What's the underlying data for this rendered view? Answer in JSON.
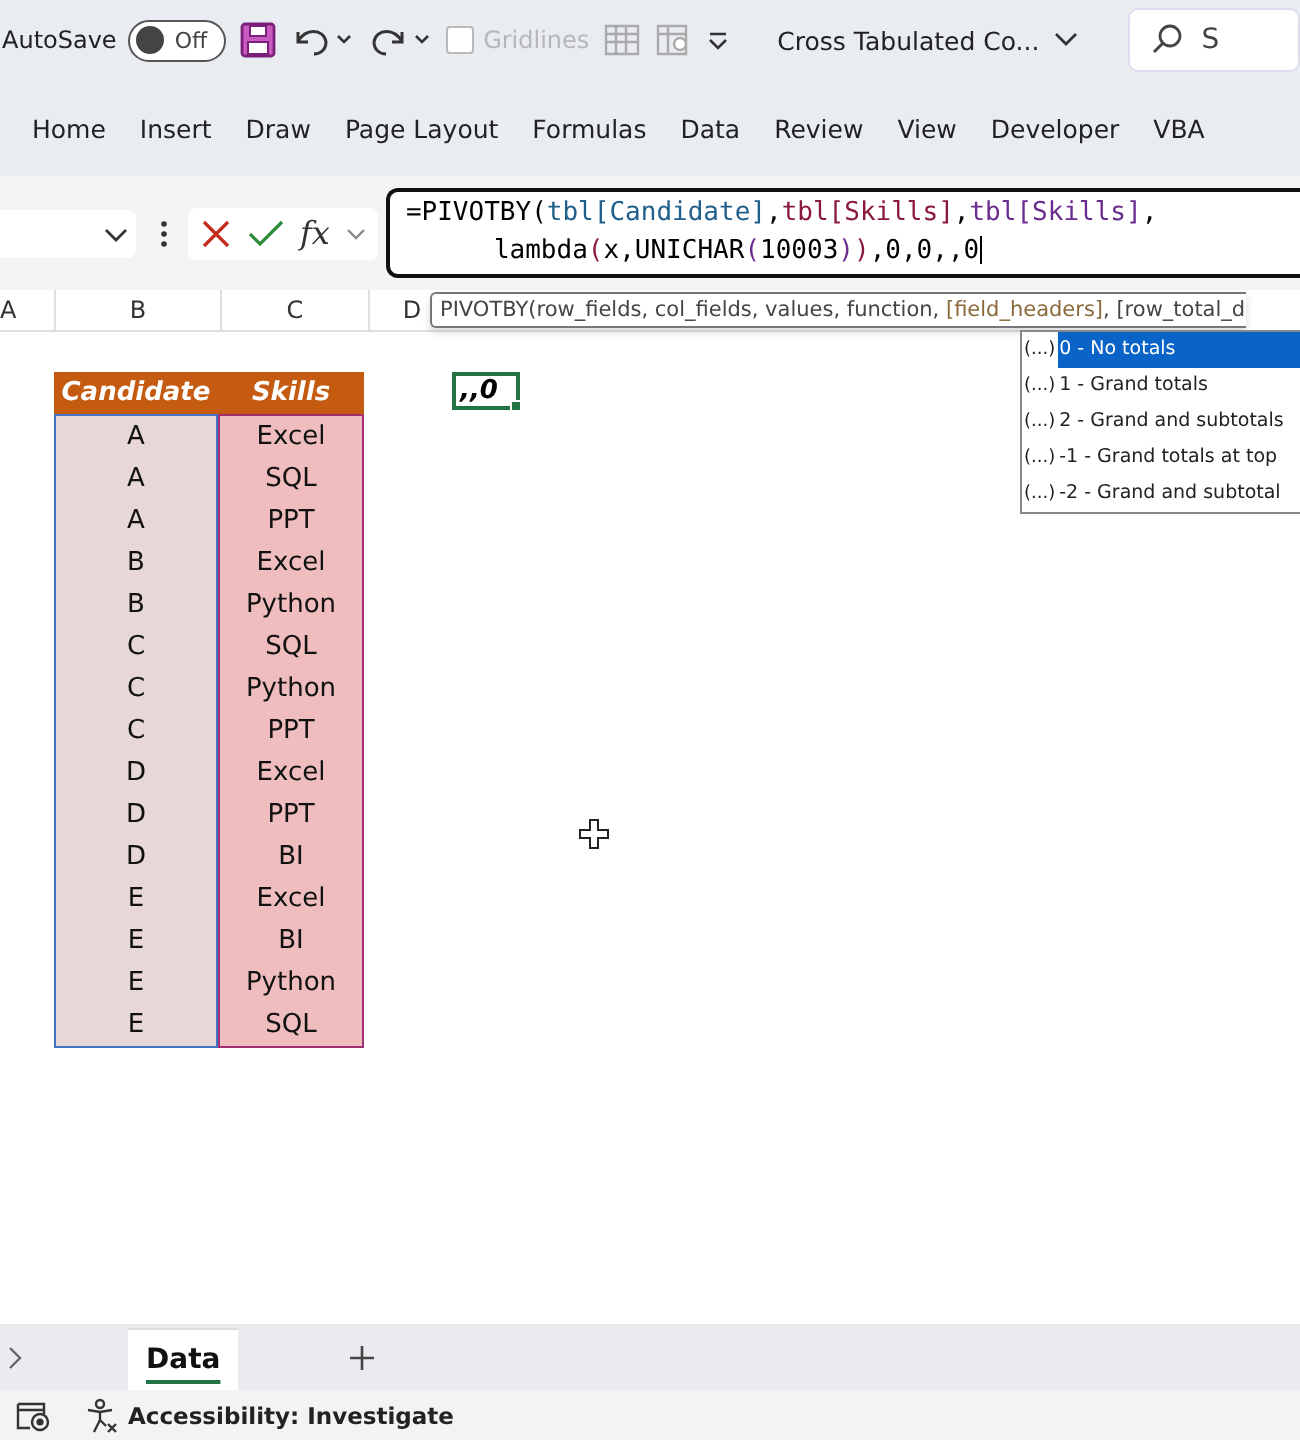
{
  "title_bar": {
    "autosave_label": "AutoSave",
    "autosave_toggle": {
      "on": false,
      "label": "Off"
    },
    "gridlines": {
      "label": "Gridlines",
      "checked": false
    },
    "document_title": "Cross Tabulated Co...",
    "search": {
      "placeholder": "S"
    }
  },
  "ribbon_tabs": [
    "Home",
    "Insert",
    "Draw",
    "Page Layout",
    "Formulas",
    "Data",
    "Review",
    "View",
    "Developer",
    "VBA"
  ],
  "formula_bar": {
    "fx": "fx",
    "formula_lines": [
      [
        {
          "text": "=PIVOTBY(",
          "color": "#000000"
        },
        {
          "text": "tbl[Candidate]",
          "color": "#1f5f8b",
          "after": ","
        },
        {
          "text": "tbl[Skills]",
          "color": "#8b1a3a",
          "after": ","
        },
        {
          "text": "tbl[Skills]",
          "color": "#6a2c8f",
          "after": ","
        }
      ],
      [
        {
          "text": "lambda",
          "color": "#000000"
        },
        {
          "text": "(",
          "color": "#8b1a3a"
        },
        {
          "text": "x,UNICHAR",
          "color": "#000000"
        },
        {
          "text": "(",
          "color": "#6a2c8f"
        },
        {
          "text": "10003",
          "color": "#000000"
        },
        {
          "text": ")",
          "color": "#6a2c8f"
        },
        {
          "text": ")",
          "color": "#8b1a3a"
        },
        {
          "text": ",0,0,,0",
          "color": "#000000"
        }
      ]
    ]
  },
  "column_headers": [
    "A",
    "B",
    "C",
    "D"
  ],
  "tooltip": {
    "function": "PIVOTBY(row_fields, col_fields, values, function, ",
    "current_arg": "[field_headers]",
    "rest": ", [row_total_d"
  },
  "autocomplete": [
    {
      "icon": "(...)",
      "label": "0 - No totals",
      "selected": true
    },
    {
      "icon": "(...)",
      "label": "1 - Grand totals",
      "selected": false
    },
    {
      "icon": "(...)",
      "label": "2 - Grand and subtotals",
      "selected": false
    },
    {
      "icon": "(...)",
      "label": "-1 - Grand totals at top",
      "selected": false
    },
    {
      "icon": "(...)",
      "label": "-2 - Grand and subtotal",
      "selected": false
    }
  ],
  "table": {
    "columns": [
      "Candidate",
      "Skills"
    ],
    "rows": [
      [
        "A",
        "Excel"
      ],
      [
        "A",
        "SQL"
      ],
      [
        "A",
        "PPT"
      ],
      [
        "B",
        "Excel"
      ],
      [
        "B",
        "Python"
      ],
      [
        "C",
        "SQL"
      ],
      [
        "C",
        "Python"
      ],
      [
        "C",
        "PPT"
      ],
      [
        "D",
        "Excel"
      ],
      [
        "D",
        "PPT"
      ],
      [
        "D",
        "BI"
      ],
      [
        "E",
        "Excel"
      ],
      [
        "E",
        "BI"
      ],
      [
        "E",
        "Python"
      ],
      [
        "E",
        "SQL"
      ]
    ]
  },
  "active_cell": {
    "value": ",,0"
  },
  "sheet_tabs": [
    {
      "label": "Data",
      "selected": true
    }
  ],
  "status_bar": {
    "accessibility": "Accessibility: Investigate"
  }
}
